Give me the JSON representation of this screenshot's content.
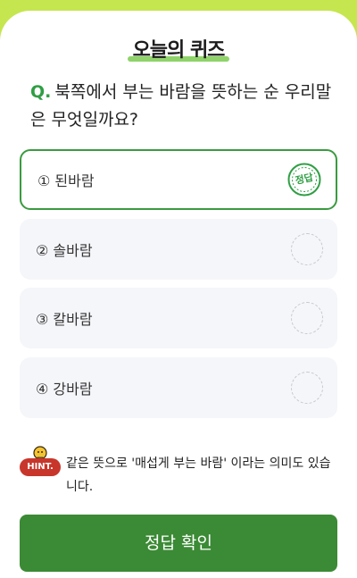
{
  "header": {
    "title": "오늘의 퀴즈"
  },
  "question": {
    "marker": "Q.",
    "text": "북쪽에서 부는 바람을 뜻하는 순 우리말은 무엇일까요?"
  },
  "options": [
    {
      "label": "① 된바람",
      "state": "correct",
      "stamp": "정답"
    },
    {
      "label": "② 솔바람",
      "state": "unselected"
    },
    {
      "label": "③ 칼바람",
      "state": "unselected"
    },
    {
      "label": "④ 강바람",
      "state": "unselected"
    }
  ],
  "hint": {
    "badge": "HINT.",
    "text": "같은 뜻으로 '매섭게 부는 바람' 이라는 의미도 있습니다."
  },
  "confirm_button": {
    "label": "정답 확인"
  },
  "colors": {
    "background": "#c5e64f",
    "accent": "#3b8a35",
    "hint_badge": "#c8362b"
  }
}
